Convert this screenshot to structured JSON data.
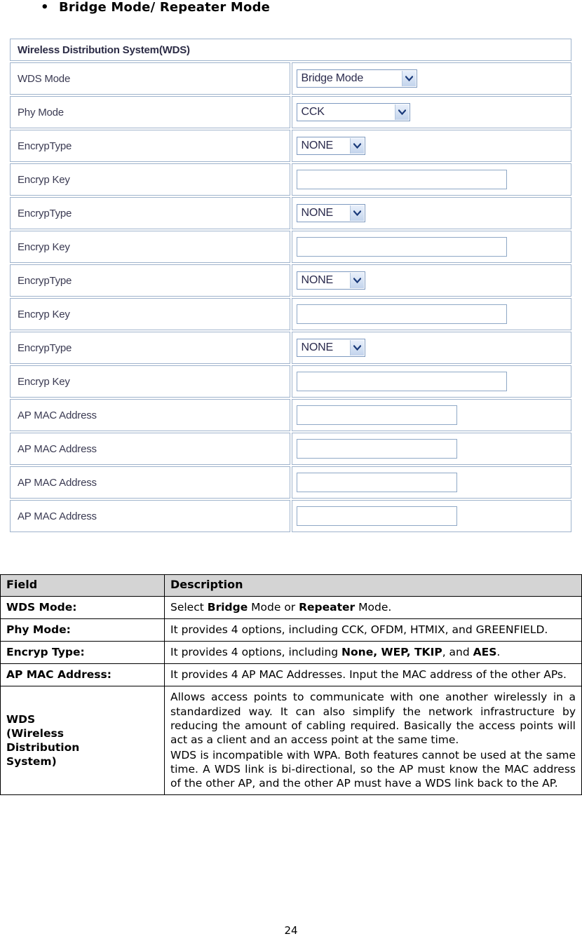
{
  "heading": {
    "bullet": "•",
    "text": "Bridge Mode/ Repeater Mode"
  },
  "wds_form": {
    "title": "Wireless Distribution System(WDS)",
    "rows": [
      {
        "label": "WDS Mode",
        "control": "select",
        "value": "Bridge Mode"
      },
      {
        "label": "Phy Mode",
        "control": "select",
        "value": "CCK"
      },
      {
        "label": "EncrypType",
        "control": "select",
        "value": "NONE"
      },
      {
        "label": "Encryp Key",
        "control": "text",
        "value": ""
      },
      {
        "label": "EncrypType",
        "control": "select",
        "value": "NONE"
      },
      {
        "label": "Encryp Key",
        "control": "text",
        "value": ""
      },
      {
        "label": "EncrypType",
        "control": "select",
        "value": "NONE"
      },
      {
        "label": "Encryp Key",
        "control": "text",
        "value": ""
      },
      {
        "label": "EncrypType",
        "control": "select",
        "value": "NONE"
      },
      {
        "label": "Encryp Key",
        "control": "text",
        "value": ""
      },
      {
        "label": "AP MAC Address",
        "control": "text",
        "value": ""
      },
      {
        "label": "AP MAC Address",
        "control": "text",
        "value": ""
      },
      {
        "label": "AP MAC Address",
        "control": "text",
        "value": ""
      },
      {
        "label": "AP MAC Address",
        "control": "text",
        "value": ""
      }
    ],
    "dropdown_icon": "chevron-down-icon",
    "colors": {
      "cell_border": "#9fb3cc",
      "select_border": "#7e9ac0",
      "select_button": "#c3d4ec",
      "input_border": "#8fa8c6",
      "label_text": "#3a3a52"
    }
  },
  "description_table": {
    "headers": {
      "field": "Field",
      "description": "Description"
    },
    "rows": [
      {
        "field": "WDS Mode:",
        "description_html": "Select <b>Bridge</b> Mode or <b>Repeater</b> Mode."
      },
      {
        "field": "Phy Mode:",
        "description_html": "It provides 4 options, including CCK, OFDM, HTMIX, and GREENFIELD."
      },
      {
        "field": "Encryp Type:",
        "description_html": "It provides 4 options, including <b>None, WEP, TKIP</b>, and <b>AES</b>."
      },
      {
        "field": "AP MAC Address:",
        "description_html": "It provides 4 AP MAC Addresses. Input the MAC address of the other APs."
      },
      {
        "field": "WDS\n(Wireless\nDistribution\nSystem)",
        "description_html": "<p>Allows access points to communicate with one another wirelessly in a standardized way. It can also simplify the network infrastructure by reducing the amount of cabling required. Basically the access points will act as a client and an access point at the same time.</p><p>WDS is incompatible with WPA. Both features cannot be used at the same time. A WDS link is bi-directional, so the AP must know the MAC address of the other AP, and the other AP must have a WDS link back to the AP.</p>",
        "justify": true
      }
    ]
  },
  "page_number": "24"
}
